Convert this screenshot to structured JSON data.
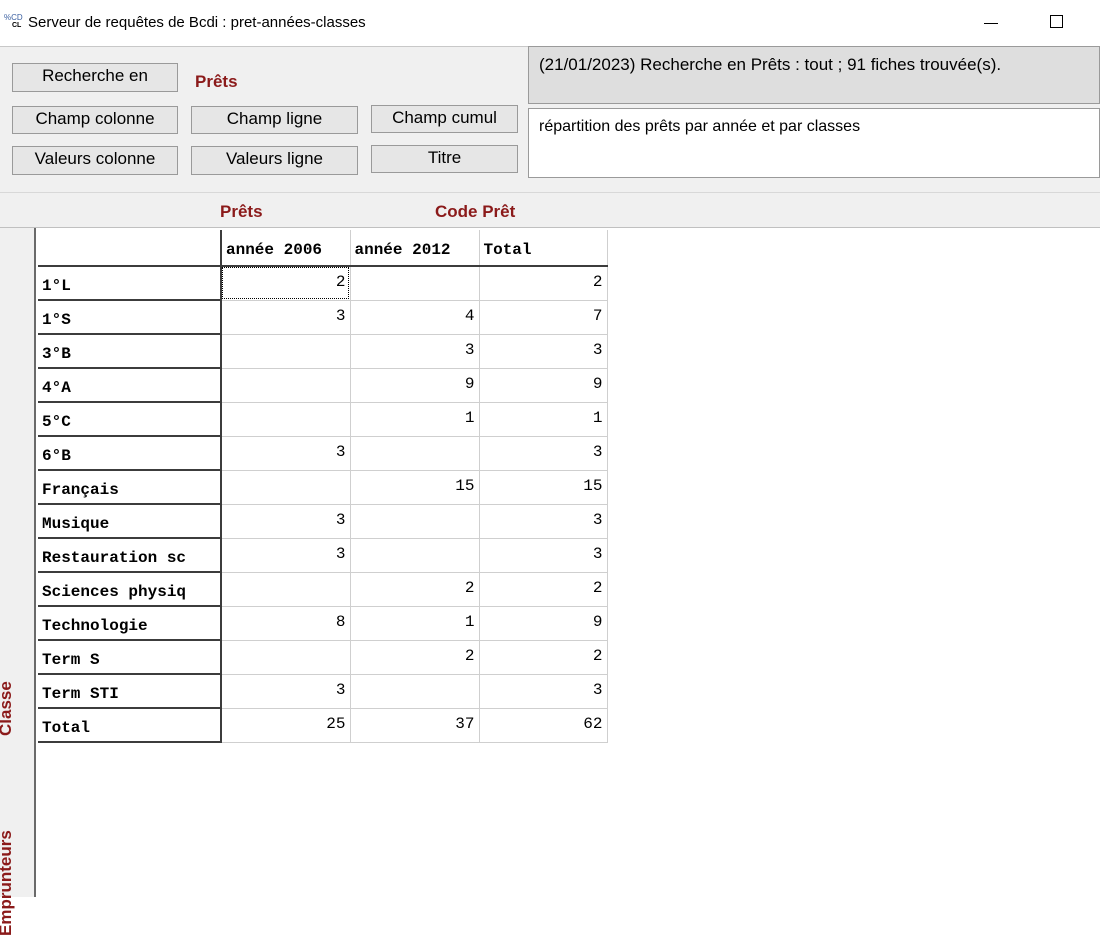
{
  "window": {
    "title": "Serveur de requêtes de Bcdi : pret-années-classes",
    "icon": "bcdi-app-icon",
    "icon_text_top": "%CD",
    "icon_text_bottom": "CL",
    "minimize": "minimize-icon",
    "maximize": "maximize-icon"
  },
  "toolbar": {
    "search_button": "Recherche en",
    "search_value": "Prêts",
    "col_field_button": "Champ colonne",
    "row_field_button": "Champ ligne",
    "cumul_field_button": "Champ cumul",
    "col_values_button": "Valeurs colonne",
    "row_values_button": "Valeurs ligne",
    "title_button": "Titre",
    "status_text": "(21/01/2023) Recherche en  Prêts  : tout ; 91 fiches trouvée(s).",
    "title_text": "répartition des prêts par année et par classes"
  },
  "fields": {
    "column_field_base": "Prêts",
    "column_field_name": "Code Prêt",
    "row_field_base": "Emprunteurs",
    "row_field_name": "Classe"
  },
  "grid": {
    "columns": [
      "",
      "année 2006",
      "année 2012",
      "Total"
    ],
    "rows": [
      {
        "label": "1°L",
        "cells": [
          "2",
          "",
          "2"
        ]
      },
      {
        "label": "1°S",
        "cells": [
          "3",
          "4",
          "7"
        ]
      },
      {
        "label": "3°B",
        "cells": [
          "",
          "3",
          "3"
        ]
      },
      {
        "label": "4°A",
        "cells": [
          "",
          "9",
          "9"
        ]
      },
      {
        "label": "5°C",
        "cells": [
          "",
          "1",
          "1"
        ]
      },
      {
        "label": "6°B",
        "cells": [
          "3",
          "",
          "3"
        ]
      },
      {
        "label": "Français",
        "cells": [
          "",
          "15",
          "15"
        ]
      },
      {
        "label": "Musique",
        "cells": [
          "3",
          "",
          "3"
        ]
      },
      {
        "label": "Restauration sc",
        "cells": [
          "3",
          "",
          "3"
        ]
      },
      {
        "label": "Sciences physiq",
        "cells": [
          "",
          "2",
          "2"
        ]
      },
      {
        "label": "Technologie",
        "cells": [
          "8",
          "1",
          "9"
        ]
      },
      {
        "label": "Term S",
        "cells": [
          "",
          "2",
          "2"
        ]
      },
      {
        "label": "Term STI",
        "cells": [
          "3",
          "",
          "3"
        ]
      },
      {
        "label": "Total",
        "cells": [
          "25",
          "37",
          "62"
        ]
      }
    ]
  }
}
